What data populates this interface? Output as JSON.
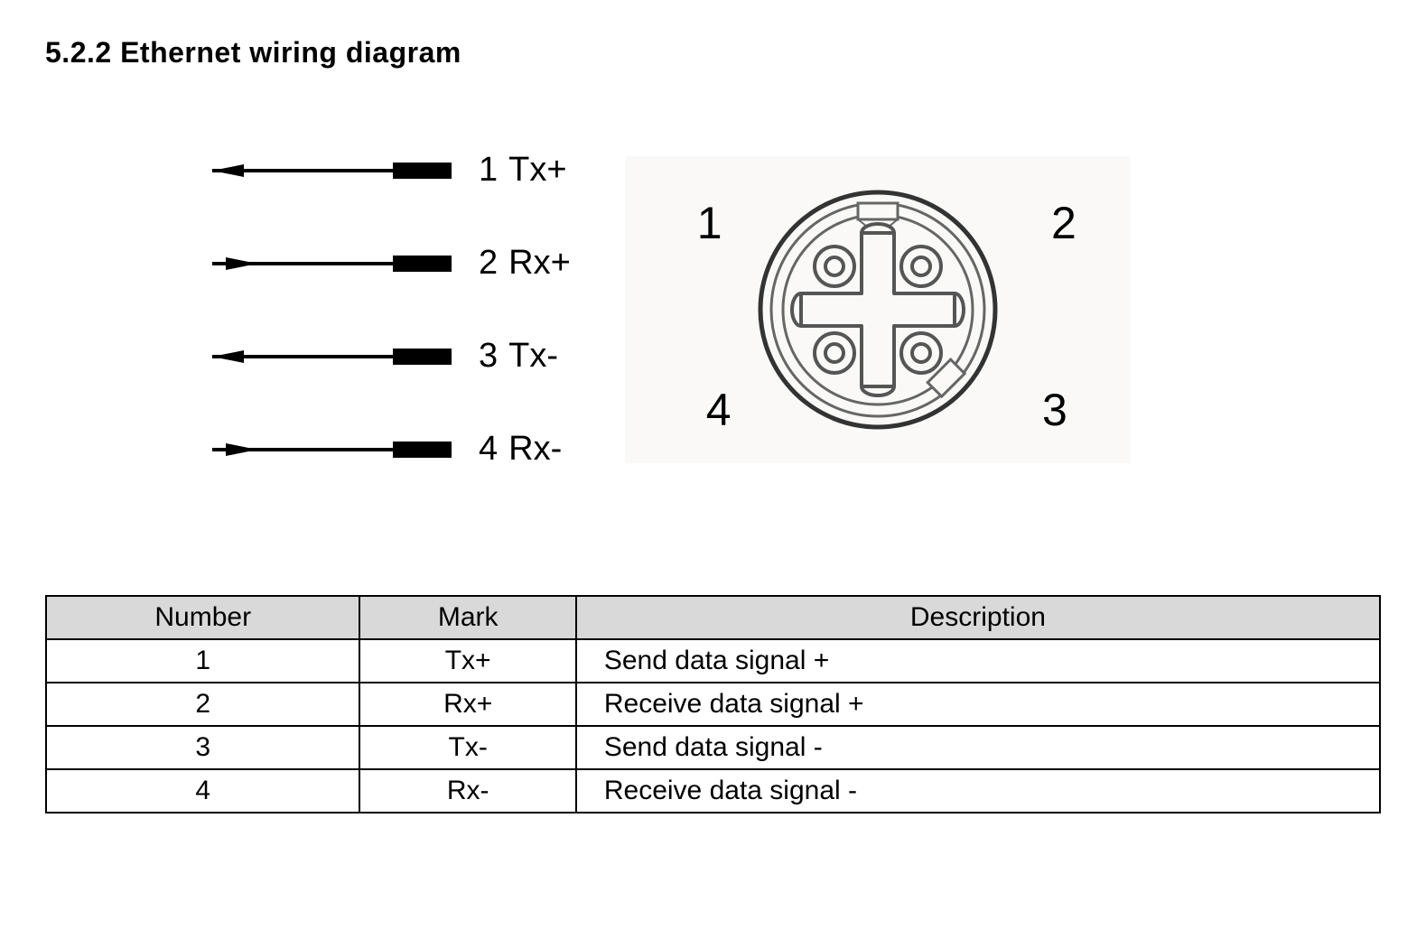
{
  "section": {
    "heading": "5.2.2 Ethernet wiring diagram"
  },
  "diagram": {
    "signals": [
      {
        "dir": "out",
        "num": "1",
        "name": "Tx+"
      },
      {
        "dir": "in",
        "num": "2",
        "name": "Rx+"
      },
      {
        "dir": "out",
        "num": "3",
        "name": "Tx-"
      },
      {
        "dir": "in",
        "num": "4",
        "name": "Rx-"
      }
    ],
    "connector": {
      "pins": {
        "1": "1",
        "2": "2",
        "3": "3",
        "4": "4"
      }
    }
  },
  "table": {
    "headers": [
      "Number",
      "Mark",
      "Description"
    ],
    "rows": [
      {
        "number": "1",
        "mark": "Tx+",
        "description": "Send data signal +"
      },
      {
        "number": "2",
        "mark": "Rx+",
        "description": "Receive data signal +"
      },
      {
        "number": "3",
        "mark": "Tx-",
        "description": "Send data signal -"
      },
      {
        "number": "4",
        "mark": "Rx-",
        "description": "Receive data signal -"
      }
    ]
  }
}
